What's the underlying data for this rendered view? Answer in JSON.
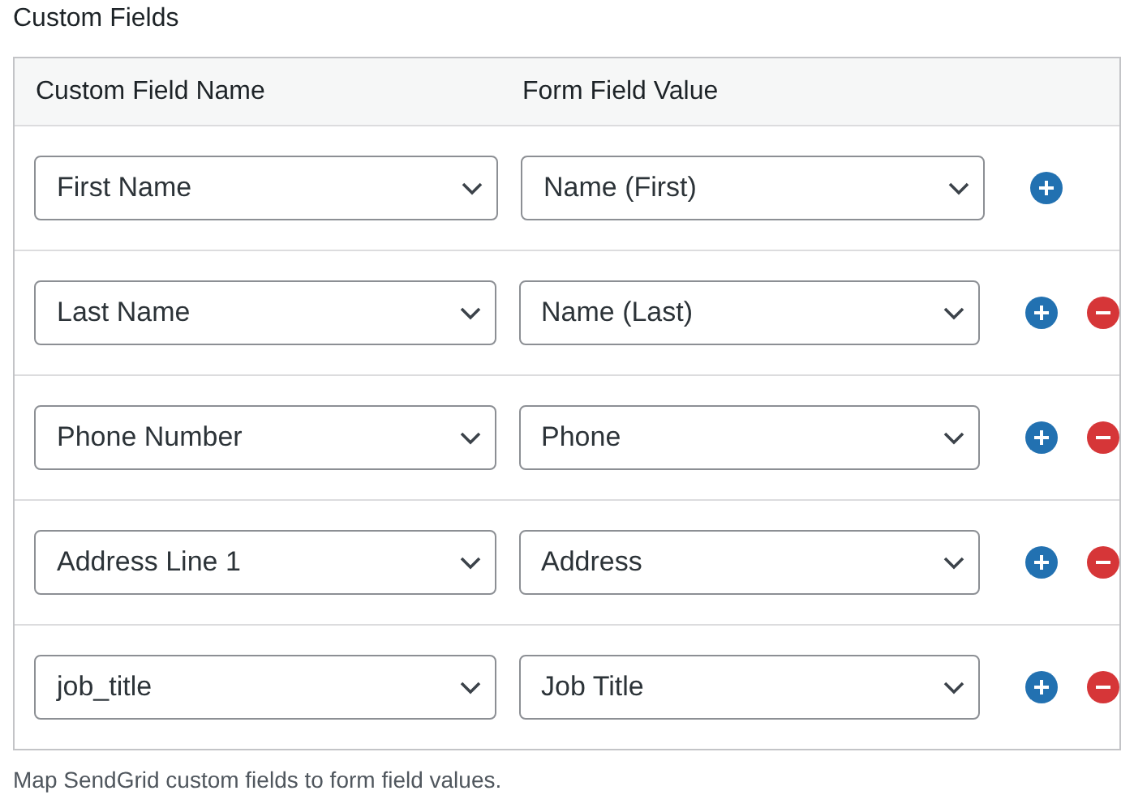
{
  "title": "Custom Fields",
  "table": {
    "columns": [
      "Custom Field Name",
      "Form Field Value"
    ],
    "rows": [
      {
        "name": "First Name",
        "value": "Name (First)",
        "actions": [
          {
            "kind": "add"
          }
        ]
      },
      {
        "name": "Last Name",
        "value": "Name (Last)",
        "actions": [
          {
            "kind": "add"
          },
          {
            "kind": "remove"
          }
        ]
      },
      {
        "name": "Phone Number",
        "value": "Phone",
        "actions": [
          {
            "kind": "add"
          },
          {
            "kind": "remove"
          }
        ]
      },
      {
        "name": "Address Line 1",
        "value": "Address",
        "actions": [
          {
            "kind": "add"
          },
          {
            "kind": "remove"
          }
        ]
      },
      {
        "name": "job_title",
        "value": "Job Title",
        "actions": [
          {
            "kind": "add"
          },
          {
            "kind": "remove"
          }
        ]
      }
    ]
  },
  "description": "Map SendGrid custom fields to form field values."
}
